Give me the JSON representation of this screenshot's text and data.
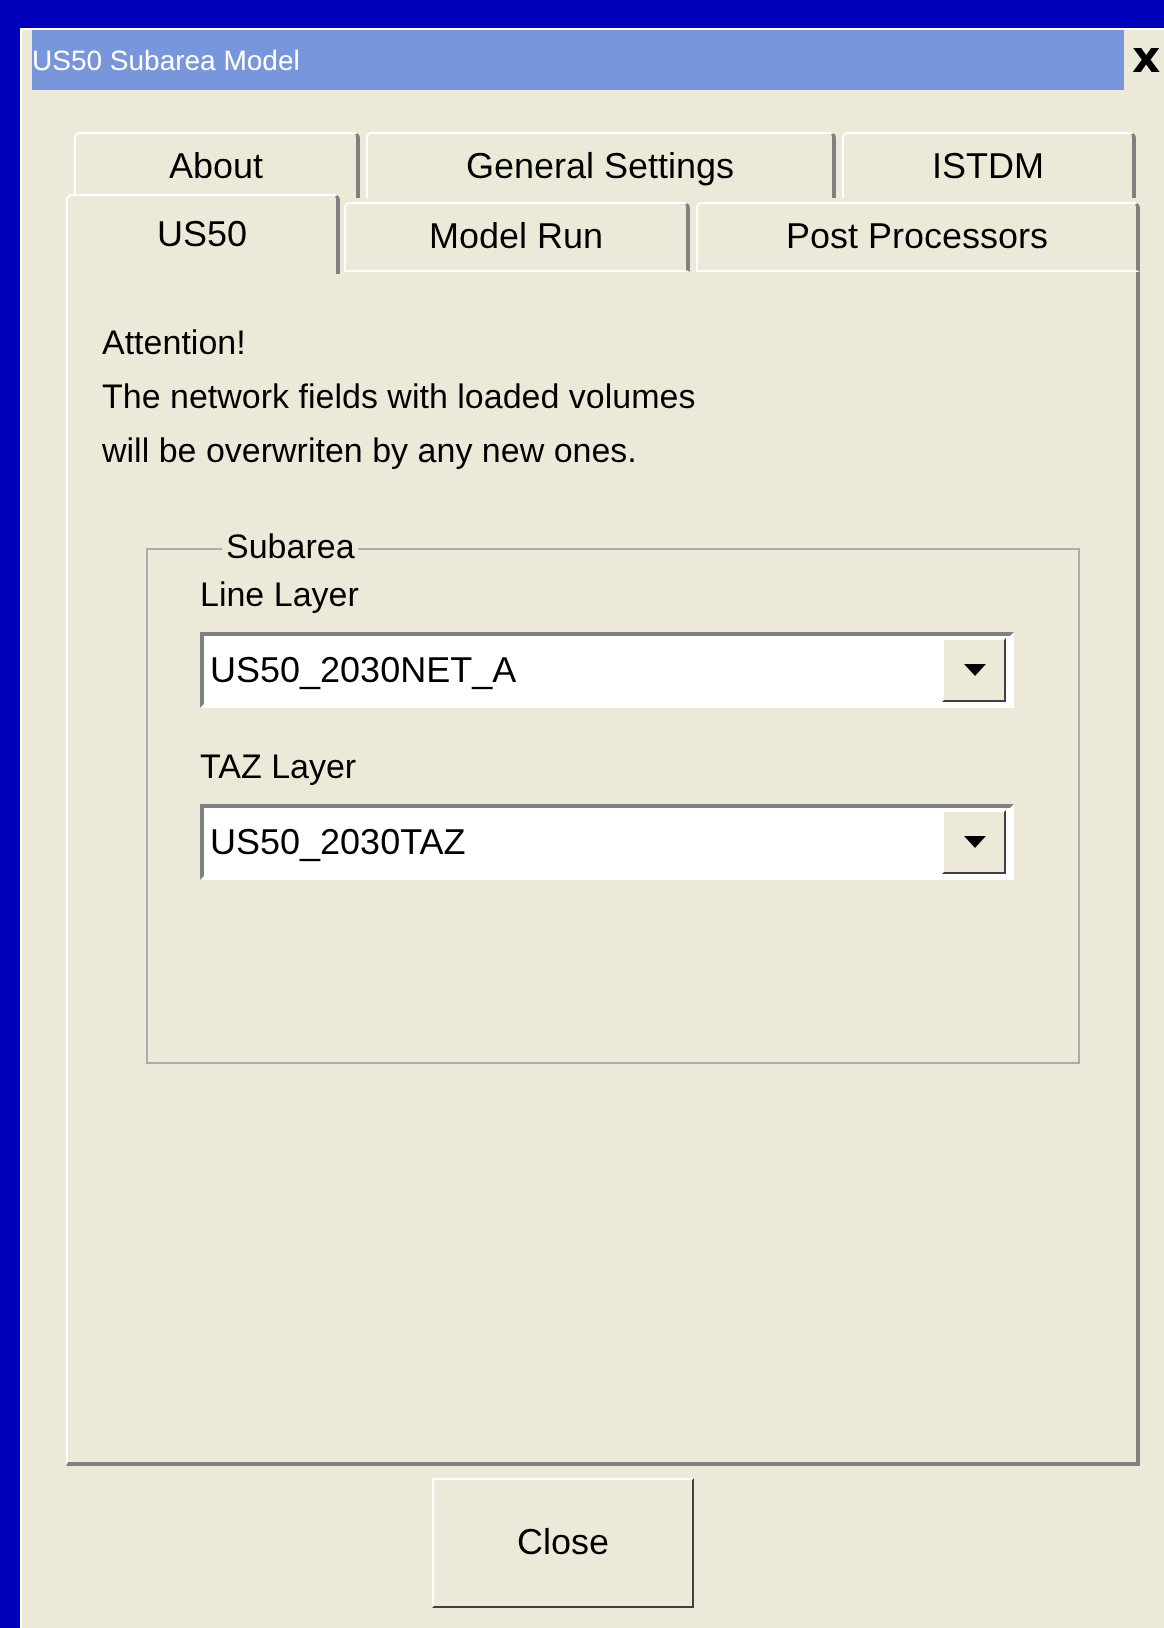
{
  "window": {
    "title": "US50 Subarea Model",
    "close_glyph": "x"
  },
  "tab_rows": [
    [
      {
        "label": "About",
        "selected": false
      },
      {
        "label": "General Settings",
        "selected": false
      },
      {
        "label": "ISTDM",
        "selected": false
      }
    ],
    [
      {
        "label": "US50",
        "selected": true
      },
      {
        "label": "Model Run",
        "selected": false
      },
      {
        "label": "Post Processors",
        "selected": false
      }
    ]
  ],
  "notice": [
    "Attention!",
    "The network fields with loaded volumes",
    "will be overwriten by any new ones."
  ],
  "group": {
    "title": "Subarea",
    "fields": [
      {
        "label": "Line Layer",
        "value": "US50_2030NET_A"
      },
      {
        "label": "TAZ Layer",
        "value": "US50_2030TAZ"
      }
    ]
  },
  "buttons": [
    "Close"
  ]
}
